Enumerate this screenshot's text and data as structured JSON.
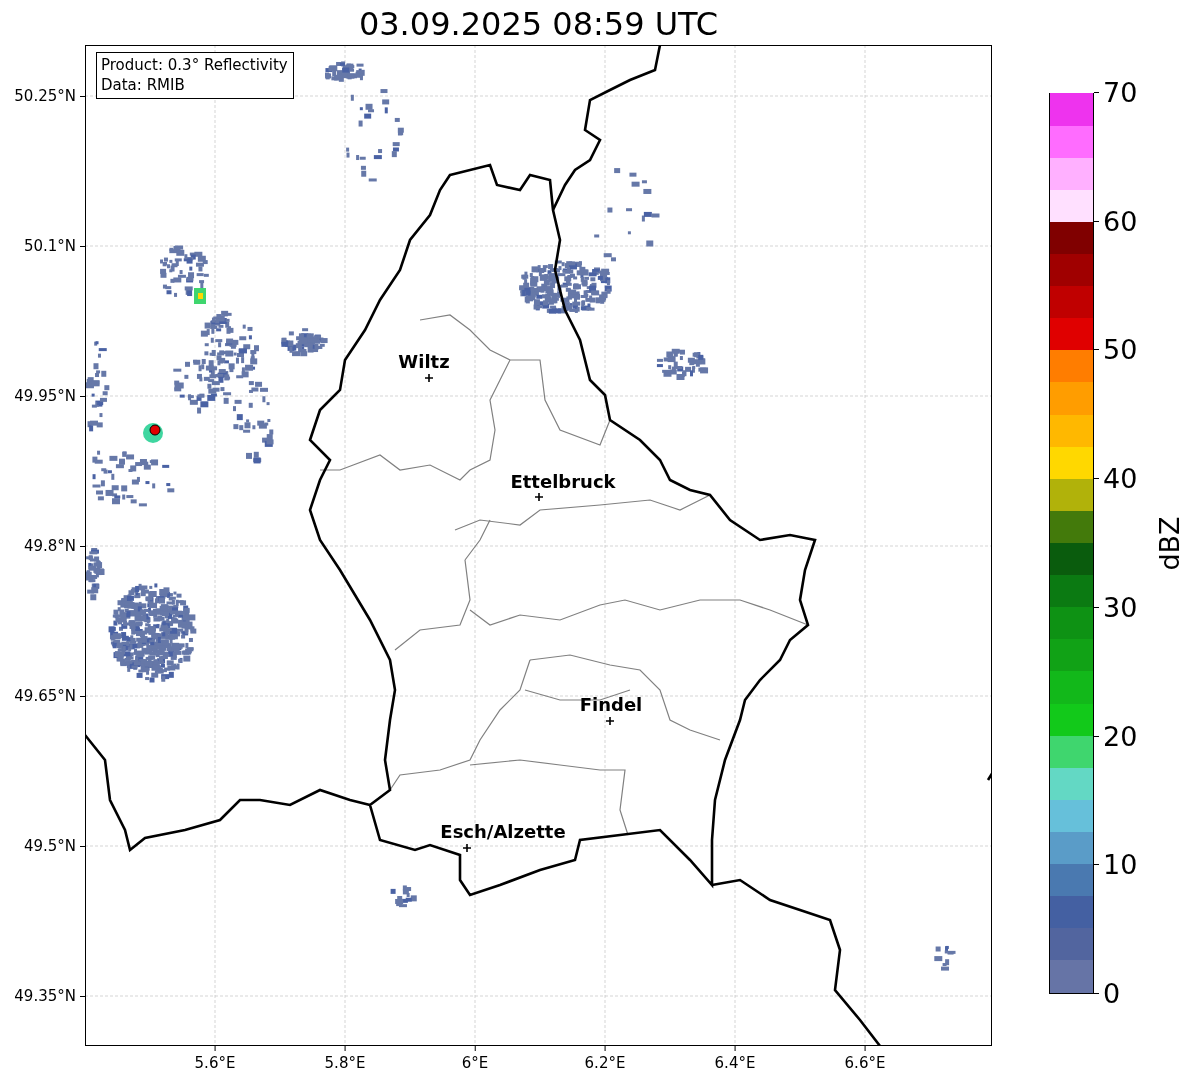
{
  "title": "03.09.2025 08:59 UTC",
  "info_box": [
    "Product: 0.3° Reflectivity",
    "Data: RMIB"
  ],
  "lat_ticks": [
    "50.25°N",
    "50.1°N",
    "49.95°N",
    "49.8°N",
    "49.65°N",
    "49.5°N",
    "49.35°N"
  ],
  "lon_ticks": [
    "5.6°E",
    "5.8°E",
    "6°E",
    "6.2°E",
    "6.4°E",
    "6.6°E"
  ],
  "cities": [
    {
      "name": "Wiltz"
    },
    {
      "name": "Ettelbruck"
    },
    {
      "name": "Findel"
    },
    {
      "name": "Esch/Alzette"
    }
  ],
  "colorbar": {
    "label": "dBZ",
    "ticks": [
      "70",
      "60",
      "50",
      "40",
      "30",
      "20",
      "10",
      "0"
    ],
    "segments": [
      {
        "color": "#6674a6"
      },
      {
        "color": "#52659f"
      },
      {
        "color": "#4460a2"
      },
      {
        "color": "#4a79b0"
      },
      {
        "color": "#5a9cc8"
      },
      {
        "color": "#66c0da"
      },
      {
        "color": "#63d8c4"
      },
      {
        "color": "#3fd66e"
      },
      {
        "color": "#12c91a"
      },
      {
        "color": "#12b81a"
      },
      {
        "color": "#11a216"
      },
      {
        "color": "#0e9214"
      },
      {
        "color": "#0b7a12"
      },
      {
        "color": "#0a5c0d"
      },
      {
        "color": "#437a0b"
      },
      {
        "color": "#b1b20a"
      },
      {
        "color": "#ffd800"
      },
      {
        "color": "#ffb800"
      },
      {
        "color": "#ff9d00"
      },
      {
        "color": "#ff7d00"
      },
      {
        "color": "#e00000"
      },
      {
        "color": "#c00000"
      },
      {
        "color": "#a00000"
      },
      {
        "color": "#800000"
      },
      {
        "color": "#ffe0ff"
      },
      {
        "color": "#ffb0ff"
      },
      {
        "color": "#ff6cff"
      },
      {
        "color": "#ee33ee"
      }
    ]
  }
}
